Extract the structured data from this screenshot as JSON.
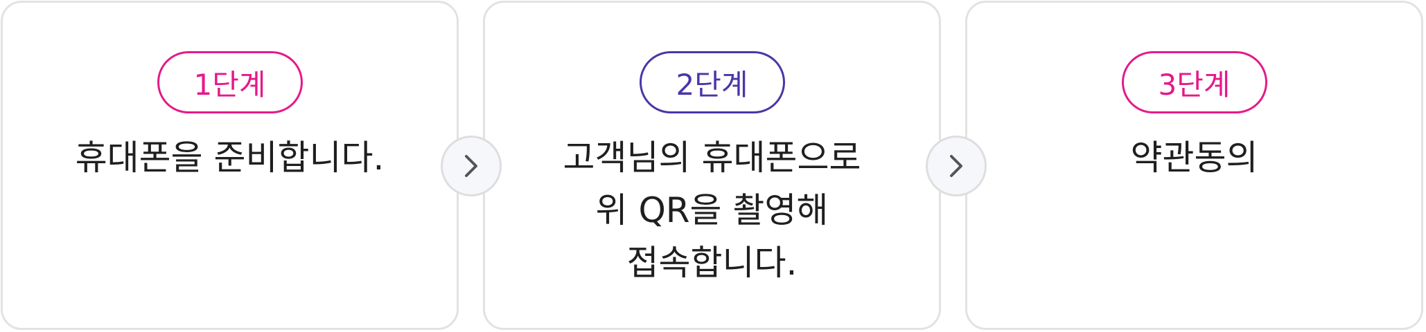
{
  "steps": [
    {
      "label": "1단계",
      "desc": "휴대폰을 준비합니다."
    },
    {
      "label": "2단계",
      "desc": "고객님의 휴대폰으로\n위 QR을 촬영해\n접속합니다."
    },
    {
      "label": "3단계",
      "desc": "약관동의"
    }
  ],
  "icons": {
    "arrow": "chevron-right-icon"
  },
  "colors": {
    "pink": "#e5198a",
    "purple": "#4b35a6",
    "border": "#e2e2e2",
    "text": "#1f1f1f"
  }
}
